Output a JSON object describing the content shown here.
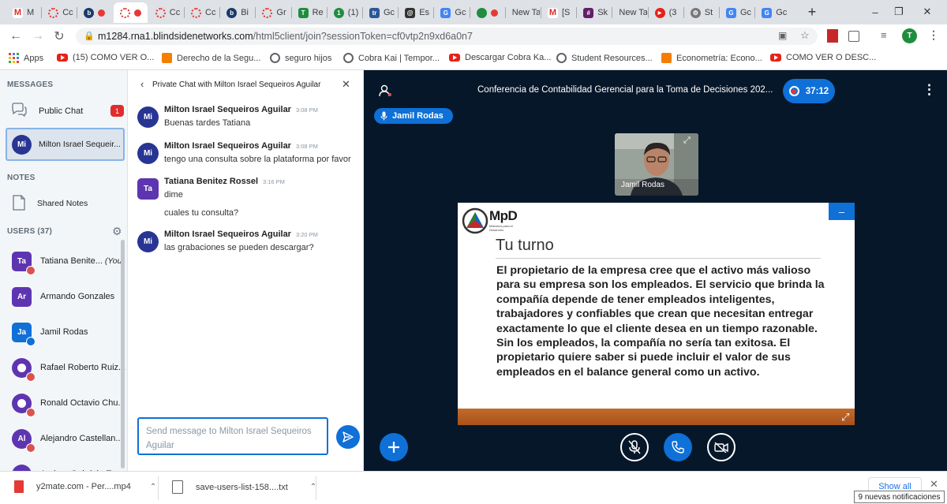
{
  "browser": {
    "tabs": [
      {
        "label": "M",
        "icon": "gmail"
      },
      {
        "label": "Cc",
        "icon": "record"
      },
      {
        "label": "",
        "icon": "blindside-rec",
        "active": false
      },
      {
        "label": "",
        "icon": "record-active",
        "active": true
      },
      {
        "label": "Cc",
        "icon": "record"
      },
      {
        "label": "Cc",
        "icon": "record"
      },
      {
        "label": "Bi",
        "icon": "blindside"
      },
      {
        "label": "Gr",
        "icon": "record"
      },
      {
        "label": "Re",
        "icon": "green-t"
      },
      {
        "label": "(1)",
        "icon": "green-1"
      },
      {
        "label": "Gc",
        "icon": "tr"
      },
      {
        "label": "Es",
        "icon": "at"
      },
      {
        "label": "Gc",
        "icon": "gtranslate"
      },
      {
        "label": "",
        "icon": "chat-rec"
      },
      {
        "label": "New Ta",
        "icon": ""
      },
      {
        "label": "[S",
        "icon": "gmail"
      },
      {
        "label": "Sk",
        "icon": "slack"
      },
      {
        "label": "New Ta",
        "icon": ""
      },
      {
        "label": "(3",
        "icon": "youtube"
      },
      {
        "label": "St",
        "icon": "gear"
      },
      {
        "label": "Gc",
        "icon": "gtranslate"
      },
      {
        "label": "Gc",
        "icon": "gtranslate"
      }
    ],
    "url_domain": "m1284.rna1.blindsidenetworks.com",
    "url_path": "/html5client/join?sessionToken=cf0vtp2n9xd6a0n7",
    "profile_initial": "T",
    "bookmarks": [
      {
        "label": "Apps",
        "icon": "apps"
      },
      {
        "label": "(15) COMO VER O...",
        "icon": "youtube"
      },
      {
        "label": "Derecho de la Segu...",
        "icon": "blogger"
      },
      {
        "label": "seguro hijos",
        "icon": "globe"
      },
      {
        "label": "Cobra Kai | Tempor...",
        "icon": "globe"
      },
      {
        "label": "Descargar Cobra Ka...",
        "icon": "youtube"
      },
      {
        "label": "Student Resources...",
        "icon": "globe"
      },
      {
        "label": "Econometría: Econo...",
        "icon": "blogger"
      },
      {
        "label": "COMO VER O DESC...",
        "icon": "youtube"
      }
    ]
  },
  "sidebar": {
    "messages_title": "MESSAGES",
    "public_chat": {
      "label": "Public Chat",
      "unread": "1"
    },
    "private_chat": {
      "label": "Milton Israel Sequeir...",
      "initials": "Mi"
    },
    "notes_title": "NOTES",
    "shared_notes": "Shared Notes",
    "users_title": "USERS (37)",
    "users": [
      {
        "initials": "Ta",
        "name": "Tatiana Benite...",
        "you": "(You)",
        "color": "#5e35b1",
        "shape": "square"
      },
      {
        "initials": "Ar",
        "name": "Armando Gonzales",
        "you": "",
        "color": "#5e35b1",
        "shape": "square"
      },
      {
        "initials": "Ja",
        "name": "Jamil Rodas",
        "you": "",
        "color": "#0f70d7",
        "shape": "square"
      },
      {
        "initials": "",
        "name": "Rafael Roberto Ruiz...",
        "you": "",
        "color": "#5e35b1",
        "shape": "round"
      },
      {
        "initials": "",
        "name": "Ronald Octavio Chu...",
        "you": "",
        "color": "#5e35b1",
        "shape": "round"
      },
      {
        "initials": "Al",
        "name": "Alejandro Castellan...",
        "you": "",
        "color": "#5e35b1",
        "shape": "round"
      },
      {
        "initials": "An",
        "name": "Andrea Gabriela E...",
        "you": "",
        "color": "#5e35b1",
        "shape": "round"
      }
    ]
  },
  "chat": {
    "header": "Private Chat with Milton Israel Sequeiros Aguilar",
    "messages": [
      {
        "initials": "Mi",
        "sender": "Milton Israel Sequeiros Aguilar",
        "time": "3:08 PM",
        "lines": [
          "Buenas tardes Tatiana"
        ],
        "color": "#283593"
      },
      {
        "initials": "Mi",
        "sender": "Milton Israel Sequeiros Aguilar",
        "time": "3:08 PM",
        "lines": [
          "tengo una consulta sobre la plataforma por favor"
        ],
        "color": "#283593"
      },
      {
        "initials": "Ta",
        "sender": "Tatiana Benitez Rossel",
        "time": "3:16 PM",
        "lines": [
          "dime",
          "cuales tu consulta?"
        ],
        "color": "#5e35b1"
      },
      {
        "initials": "Mi",
        "sender": "Milton Israel Sequeiros Aguilar",
        "time": "3:20 PM",
        "lines": [
          "las grabaciones se pueden descargar?"
        ],
        "color": "#283593"
      }
    ],
    "input_placeholder": "Send message to Milton Israel Sequeiros Aguilar"
  },
  "stage": {
    "title": "Conferencia de Contabilidad Gerencial para la Toma de Decisiones 202...",
    "timer": "37:12",
    "presenter": "Jamil Rodas",
    "video_label": "Jamil Rodas",
    "slide": {
      "logo_text": "MpD",
      "logo_sub": "Maestros para el Desarrollo",
      "title": "Tu turno",
      "body": "El propietario de la empresa cree que el activo más valioso para su empresa son los empleados. El servicio que brinda la compañía depende de tener empleados inteligentes, trabajadores y confiables que crean que necesitan entregar exactamente lo que el cliente desea en un tiempo razonable. Sin los empleados, la compañía no sería tan exitosa. El propietario quiere saber si puede incluir el valor de sus empleados en el balance general como un activo."
    }
  },
  "downloads": {
    "items": [
      {
        "name": "y2mate.com - Per....mp4"
      },
      {
        "name": "save-users-list-158....txt"
      }
    ],
    "show_all": "Show all",
    "notifications": "9 nuevas notificaciones"
  },
  "colors": {
    "accent": "#0f70d7",
    "stage_bg": "#06172a",
    "slide_footer": "#b35d20",
    "danger": "#d9534f"
  }
}
